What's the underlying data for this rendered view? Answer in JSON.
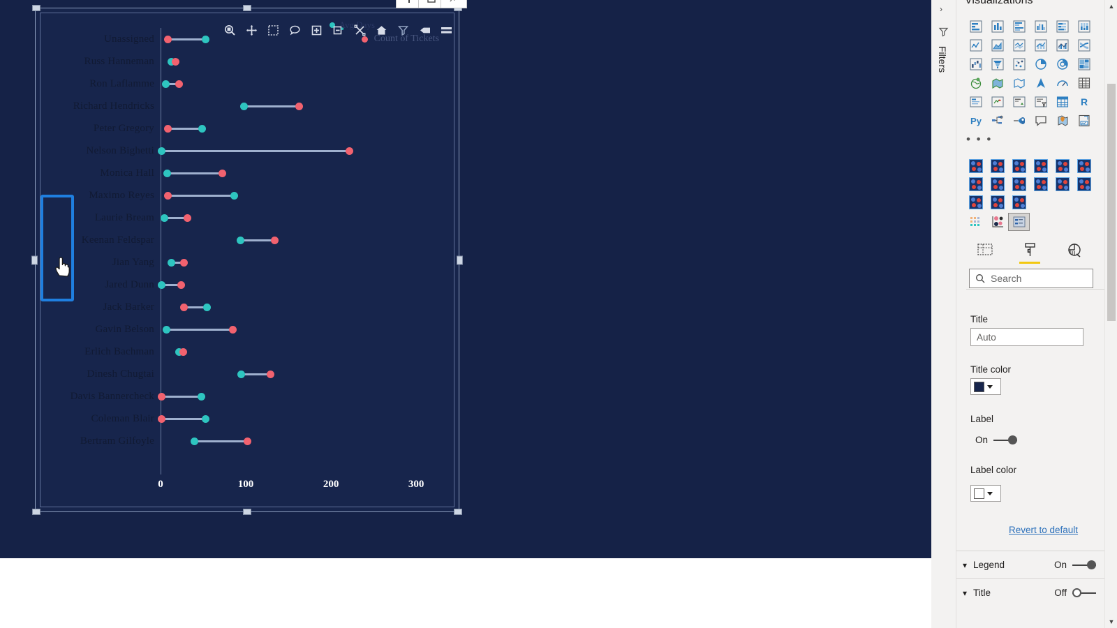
{
  "report": {
    "canvas_bg": "#152247",
    "visual_bg": "#17254c"
  },
  "chart_data": {
    "type": "bar",
    "subtype": "dumbbell",
    "title": "",
    "xlabel": "",
    "ylabel": "",
    "xlim": [
      0,
      340
    ],
    "xticks": [
      "0",
      "100",
      "200",
      "300"
    ],
    "xtick_values": [
      0,
      100,
      200,
      300
    ],
    "grid": false,
    "legend_position": "top-right",
    "legend": [
      {
        "label": "Count of Tickets",
        "color": "#f2626f"
      },
      {
        "label": "Avg Days",
        "color": "#2ec5c0"
      }
    ],
    "categories": [
      "Unassigned",
      "Russ Hanneman",
      "Ron Laflamme",
      "Richard Hendricks",
      "Peter Gregory",
      "Nelson Bighetti",
      "Monica Hall",
      "Maximo Reyes",
      "Laurie Bream",
      "Keenan Feldspar",
      "Jian Yang",
      "Jared Dunn",
      "Jack Barker",
      "Gavin Belson",
      "Erlich Bachman",
      "Dinesh Chugtai",
      "Davis Bannercheck",
      "Coleman Blair",
      "Bertram Gilfoyle"
    ],
    "series": [
      {
        "name": "Count of Tickets",
        "color": "#f2626f",
        "values": [
          8,
          17,
          21,
          162,
          8,
          221,
          72,
          8,
          31,
          133,
          27,
          23,
          27,
          84,
          26,
          128,
          0,
          0,
          101
        ]
      },
      {
        "name": "Avg Days",
        "color": "#2ec5c0",
        "values": [
          52,
          12,
          5,
          97,
          48,
          0,
          7,
          86,
          4,
          93,
          12,
          0,
          54,
          6,
          21,
          94,
          47,
          52,
          39
        ]
      }
    ]
  },
  "visual_toolbar": {
    "items": [
      {
        "name": "focus-mode-icon",
        "label": "Focus mode"
      },
      {
        "name": "drill-mode-icon",
        "label": "Drill mode"
      },
      {
        "name": "select-region-icon",
        "label": "Select region"
      },
      {
        "name": "comment-icon",
        "label": "Comment"
      },
      {
        "name": "drill-down-icon",
        "label": "Drill down"
      },
      {
        "name": "drill-up-icon",
        "label": "Drill up"
      },
      {
        "name": "expand-all-icon",
        "label": "Expand all"
      },
      {
        "name": "home-icon",
        "label": "Home"
      },
      {
        "name": "filter-icon",
        "label": "Filters"
      },
      {
        "name": "eraser-icon",
        "label": "Reset"
      },
      {
        "name": "more-options-icon",
        "label": "More options"
      }
    ]
  },
  "filters_rail": {
    "label": "Filters",
    "icon": "filter-funnel-icon",
    "chevron": "›"
  },
  "visualizations_pane": {
    "title": "Visualizations",
    "more_label": "• • •",
    "chart_icons": [
      "stacked-bar-chart-icon",
      "stacked-column-chart-icon",
      "clustered-bar-chart-icon",
      "clustered-column-chart-icon",
      "100-stacked-bar-chart-icon",
      "100-stacked-column-chart-icon",
      "line-chart-icon",
      "area-chart-icon",
      "stacked-area-chart-icon",
      "line-stacked-column-chart-icon",
      "line-clustered-column-chart-icon",
      "ribbon-chart-icon",
      "waterfall-chart-icon",
      "funnel-chart-icon",
      "scatter-chart-icon",
      "pie-chart-icon",
      "donut-chart-icon",
      "treemap-icon",
      "map-icon",
      "filled-map-icon",
      "shape-map-icon",
      "arcgis-map-icon",
      "gauge-icon",
      "table-icon",
      "card-icon",
      "multi-row-card-icon",
      "kpi-icon",
      "slicer-icon",
      "matrix-icon",
      "r-script-visual-icon",
      "python-visual-icon",
      "decomposition-tree-icon",
      "key-influencers-icon",
      "q-and-a-icon",
      "azure-map-icon",
      "paginated-report-icon"
    ],
    "custom_visual_count": 15,
    "extra_icons": [
      "dot-plot-icon",
      "lollipop-icon",
      "selected-custom-visual-icon"
    ],
    "pane_tabs": [
      {
        "name": "fields-tab",
        "label": "Fields",
        "active": false
      },
      {
        "name": "format-tab",
        "label": "Format",
        "active": true
      },
      {
        "name": "analytics-tab",
        "label": "Analytics",
        "active": false
      }
    ],
    "search_placeholder": "Search"
  },
  "format_pane": {
    "title_section": {
      "label": "Title",
      "value": "Auto"
    },
    "title_color": {
      "label": "Title color",
      "swatch_hex": "#17254c",
      "highlighted": true
    },
    "label_toggle": {
      "label": "Label",
      "state": "On"
    },
    "label_color": {
      "label": "Label color",
      "swatch_hex": "#ffffff"
    },
    "revert_label": "Revert to default",
    "accordions": [
      {
        "label": "Legend",
        "state": "On"
      },
      {
        "label": "Title",
        "state": "Off"
      }
    ]
  }
}
